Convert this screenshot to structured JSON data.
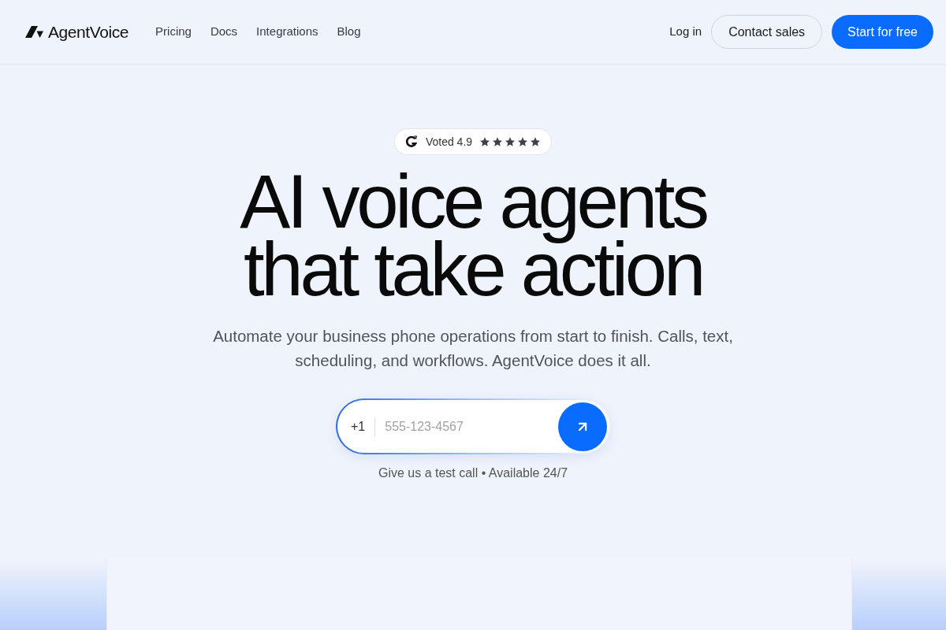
{
  "header": {
    "brand": "AgentVoice",
    "nav": [
      {
        "label": "Pricing"
      },
      {
        "label": "Docs"
      },
      {
        "label": "Integrations"
      },
      {
        "label": "Blog"
      }
    ],
    "login": "Log in",
    "contact_button": "Contact sales",
    "start_button": "Start for free"
  },
  "hero": {
    "badge": {
      "text": "Voted 4.9",
      "stars": 5
    },
    "headline": "AI voice agents that take action",
    "subtitle": "Automate your business phone operations from start to finish. Calls, text, scheduling, and workflows. AgentVoice does it all.",
    "phone": {
      "country_code": "+1",
      "placeholder": "555-123-4567"
    },
    "caption": "Give us a test call • Available 24/7"
  }
}
